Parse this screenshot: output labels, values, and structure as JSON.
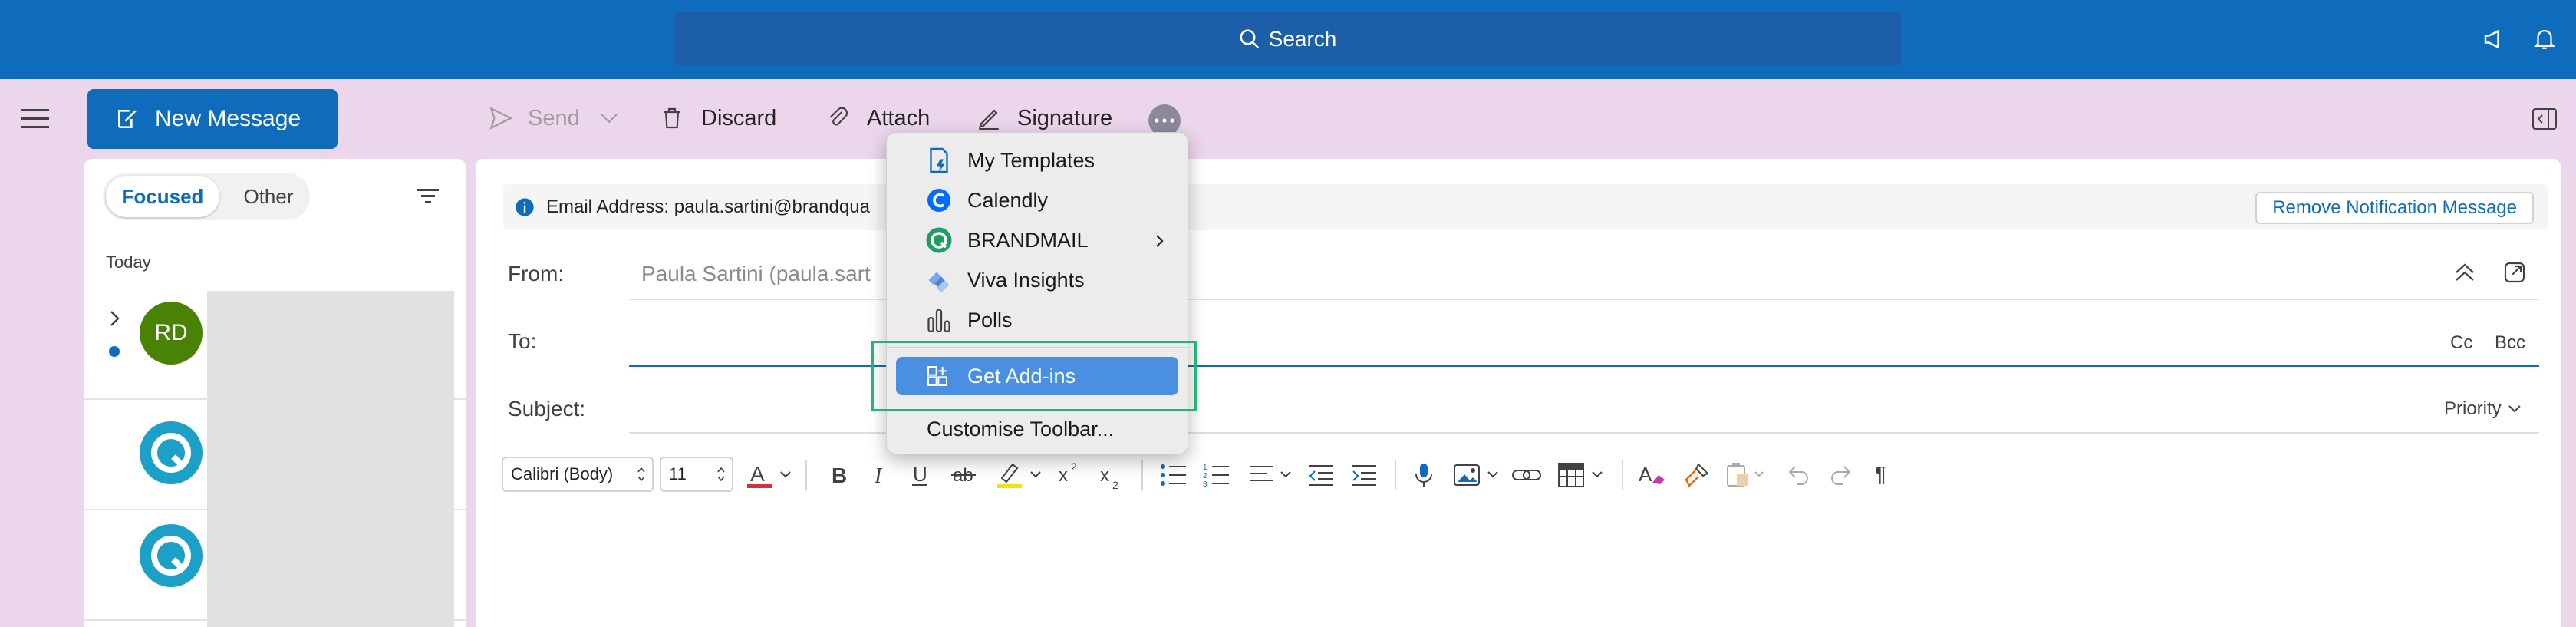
{
  "topbar": {
    "search_label": "Search"
  },
  "left": {
    "new_message_label": "New Message",
    "tabs": {
      "focused": "Focused",
      "other": "Other"
    },
    "section_today": "Today",
    "messages": [
      {
        "initials": "RD"
      }
    ]
  },
  "toolbar": {
    "send": "Send",
    "discard": "Discard",
    "attach": "Attach",
    "signature": "Signature"
  },
  "notice": {
    "text": "Email Address: paula.sartini@brandqua",
    "remove_label": "Remove Notification Message"
  },
  "fields": {
    "from_label": "From:",
    "from_value": "Paula Sartini (paula.sart",
    "to_label": "To:",
    "cc": "Cc",
    "bcc": "Bcc",
    "subject_label": "Subject:",
    "priority": "Priority"
  },
  "format": {
    "font": "Calibri (Body)",
    "size": "11"
  },
  "menu": {
    "items": [
      {
        "label": "My Templates"
      },
      {
        "label": "Calendly"
      },
      {
        "label": "BRANDMAIL"
      },
      {
        "label": "Viva Insights"
      },
      {
        "label": "Polls"
      },
      {
        "label": "Get Add-ins"
      },
      {
        "label": "Customise Toolbar..."
      }
    ]
  },
  "colors": {
    "accent": "#0f6cbd",
    "background": "#ecd6ec",
    "menu_selected": "#4a90e2",
    "highlight_box": "#22b573"
  }
}
